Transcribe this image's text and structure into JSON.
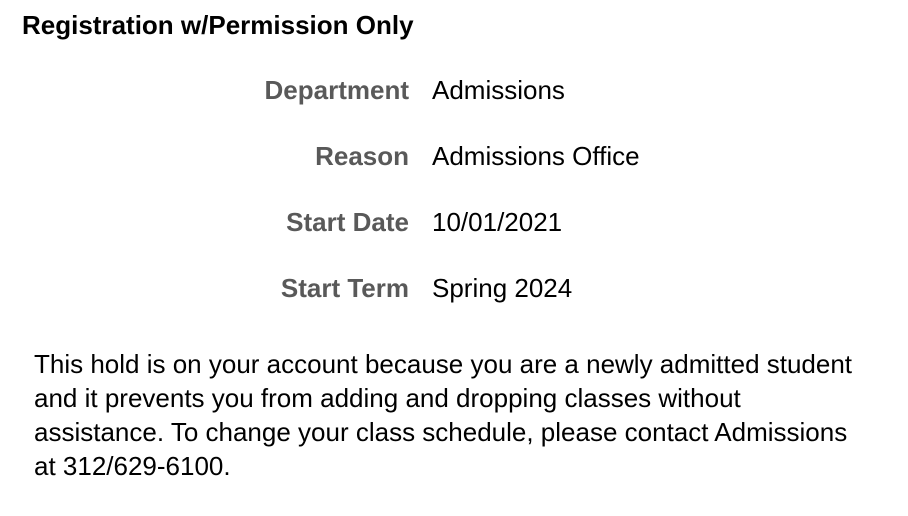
{
  "hold": {
    "title": "Registration w/Permission Only",
    "details": [
      {
        "label": "Department",
        "value": "Admissions"
      },
      {
        "label": "Reason",
        "value": "Admissions Office"
      },
      {
        "label": "Start Date",
        "value": "10/01/2021"
      },
      {
        "label": "Start Term",
        "value": "Spring 2024"
      }
    ],
    "description": "This hold is on your account because you are a newly admitted student and it prevents you from adding and dropping classes without assistance. To change your class schedule, please contact Admissions at 312/629-6100.",
    "colors": {
      "label": "#595959",
      "text": "#000000",
      "background": "#ffffff"
    }
  }
}
